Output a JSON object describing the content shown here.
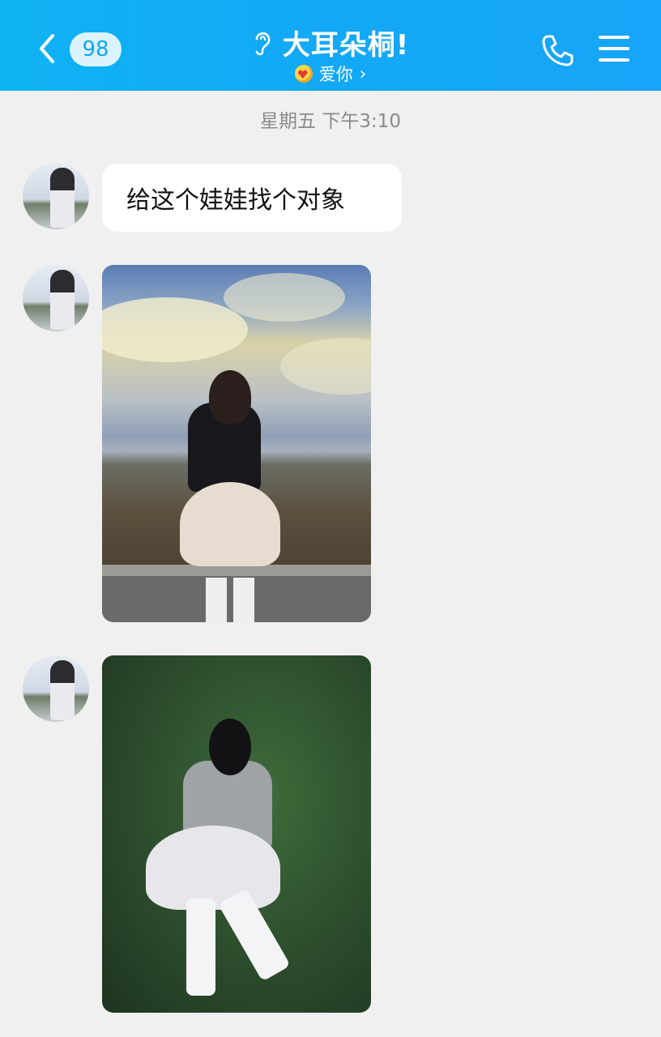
{
  "header": {
    "unread_count": "98",
    "contact_name": "大耳朵桐!",
    "status_text": "爱你",
    "status_chevron": "›",
    "icons": {
      "back": "chevron-left-icon",
      "ear": "ear-icon",
      "call": "phone-icon",
      "menu": "menu-icon",
      "status": "heart-emoji-icon"
    },
    "background_color": "#12abf5"
  },
  "chat": {
    "timestamp": "星期五 下午3:10",
    "messages": [
      {
        "type": "text",
        "text": "给这个娃娃找个对象"
      },
      {
        "type": "image"
      },
      {
        "type": "image"
      }
    ]
  }
}
